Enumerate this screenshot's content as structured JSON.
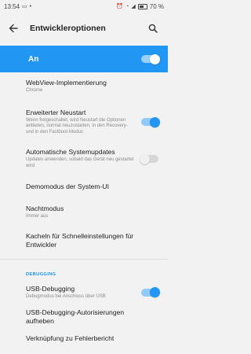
{
  "status_bar": {
    "time": "13:54",
    "battery": "70 %",
    "battery_level": 0.7
  },
  "app_bar": {
    "title": "Entwickleroptionen",
    "back_icon": "arrow-left-icon",
    "search_icon": "search-icon"
  },
  "master": {
    "label": "An",
    "enabled": true
  },
  "items": [
    {
      "title": "WebView-Implementierung",
      "subtitle": "Chrome"
    },
    {
      "title": "Erweiterter Neustart",
      "subtitle": "Wenn freigeschaltet, wird Neustart die Optionen anbieten, normal neuzustarten, in den Recovery- und in den Fastboot-Modus",
      "toggle": true
    },
    {
      "title": "Automatische Systemupdates",
      "subtitle": "Updates anwenden, sobald das Gerät neu gestartet wird",
      "toggle": false
    },
    {
      "title": "Demomodus der System-UI"
    },
    {
      "title": "Nachtmodus",
      "subtitle": "Immer aus"
    },
    {
      "title": "Kacheln für Schnelleinstellungen für Entwickler"
    }
  ],
  "debug_section": {
    "header": "DEBUGGING",
    "items": [
      {
        "title": "USB-Debugging",
        "subtitle": "Debugmodus bei Anschluss über USB",
        "toggle": true
      },
      {
        "title": "USB-Debugging-Autorisierungen aufheben"
      },
      {
        "title": "Verknüpfung zu Fehlerbericht"
      }
    ]
  },
  "colors": {
    "accent": "#2196F3",
    "background": "#f2f2f2"
  }
}
